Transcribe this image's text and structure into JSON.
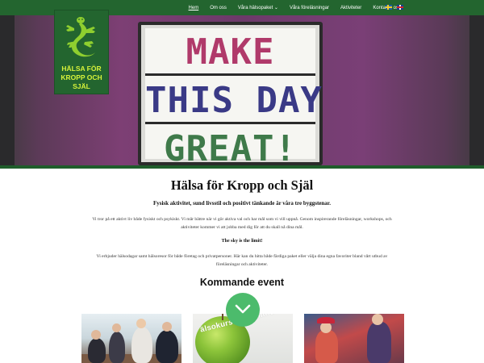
{
  "nav": {
    "items": [
      {
        "label": "Hem",
        "active": true
      },
      {
        "label": "Om oss",
        "active": false
      },
      {
        "label": "Våra hälsopaket ⌄",
        "active": false
      },
      {
        "label": "Våra föreläsningar",
        "active": false
      },
      {
        "label": "Aktiviteter",
        "active": false
      },
      {
        "label": "Kontakta oss",
        "active": false
      }
    ],
    "languages": [
      "swedish-flag-icon",
      "english-flag-icon"
    ]
  },
  "logo": {
    "line1": "HÄLSA FÖR",
    "line2": "KROPP OCH SJÄL",
    "icon": "lizard-icon"
  },
  "hero": {
    "sign_line1": "MAKE",
    "sign_line2": "THIS DAY",
    "sign_line3": "GREAT!"
  },
  "main": {
    "title": "Hälsa för Kropp och Själ",
    "tagline": "Fysisk aktivitet, sund livsstil och positivt tänkande är våra tre byggstenar.",
    "para1": "Vi tror på ett aktivt liv både fysiskt och psykiskt. Vi mår bättre när vi gör aktiva val och har mål som vi vill uppnå. Genom inspirerande föreläsningar, workshops, och aktiviteter kommer vi att jobba med dig för att du skall nå dina mål.",
    "sky": "The sky is the limit!",
    "para2": "Vi erbjuder hälsodagar samt hälsoresor för både företag och privatpersoner. Här kan du hitta både färdiga paket eller välja dina egna favoriter bland vårt utbud av föreläsningar och aktiviteter.",
    "events_heading": "Kommande event"
  },
  "cards": {
    "card2_label": "älsokurs live online"
  },
  "colors": {
    "brand_green": "#23652f",
    "logo_text": "#d6f23a",
    "scroll_button": "#4cbb6c"
  },
  "scroll_button_icon": "chevron-down-icon"
}
